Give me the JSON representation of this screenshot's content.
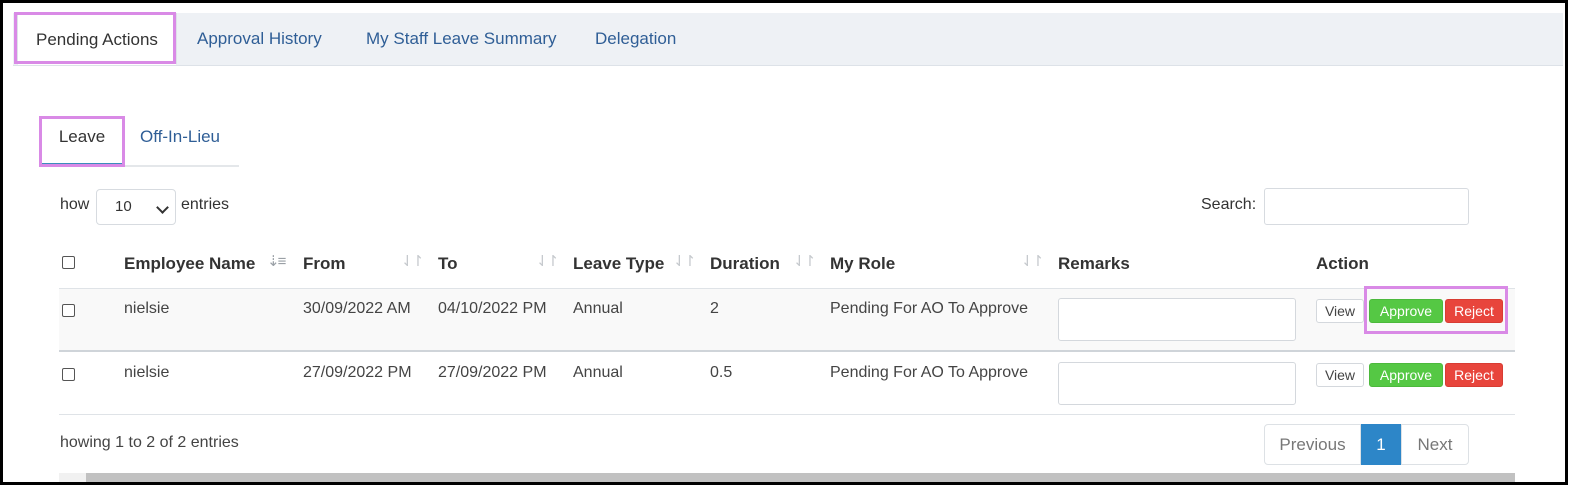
{
  "top_tabs": [
    {
      "label": "Pending Actions"
    },
    {
      "label": "Approval History"
    },
    {
      "label": "My Staff Leave Summary"
    },
    {
      "label": "Delegation"
    }
  ],
  "sub_tabs": [
    {
      "label": "Leave"
    },
    {
      "label": "Off-In-Lieu"
    }
  ],
  "length_control": {
    "prefix": "how",
    "value": "10",
    "suffix": "entries"
  },
  "search": {
    "label": "Search:",
    "value": ""
  },
  "table": {
    "headers": [
      "Employee Name",
      "From",
      "To",
      "Leave Type",
      "Duration",
      "My Role",
      "Remarks",
      "Action"
    ],
    "rows": [
      {
        "employee": "nielsie",
        "from": "30/09/2022 AM",
        "to": "04/10/2022 PM",
        "type": "Annual",
        "duration": "2",
        "role": "Pending For AO To Approve",
        "remarks": ""
      },
      {
        "employee": "nielsie",
        "from": "27/09/2022 PM",
        "to": "27/09/2022 PM",
        "type": "Annual",
        "duration": "0.5",
        "role": "Pending For AO To Approve",
        "remarks": ""
      }
    ],
    "actions": {
      "view": "View",
      "approve": "Approve",
      "reject": "Reject"
    }
  },
  "info": "howing 1 to 2 of 2 entries",
  "pagination": {
    "previous": "Previous",
    "current": "1",
    "next": "Next"
  },
  "colors": {
    "approve": "#55c844",
    "reject": "#e8453c",
    "page_active": "#2d86c8",
    "highlight": "#d98ae6",
    "link": "#2f5e96"
  }
}
